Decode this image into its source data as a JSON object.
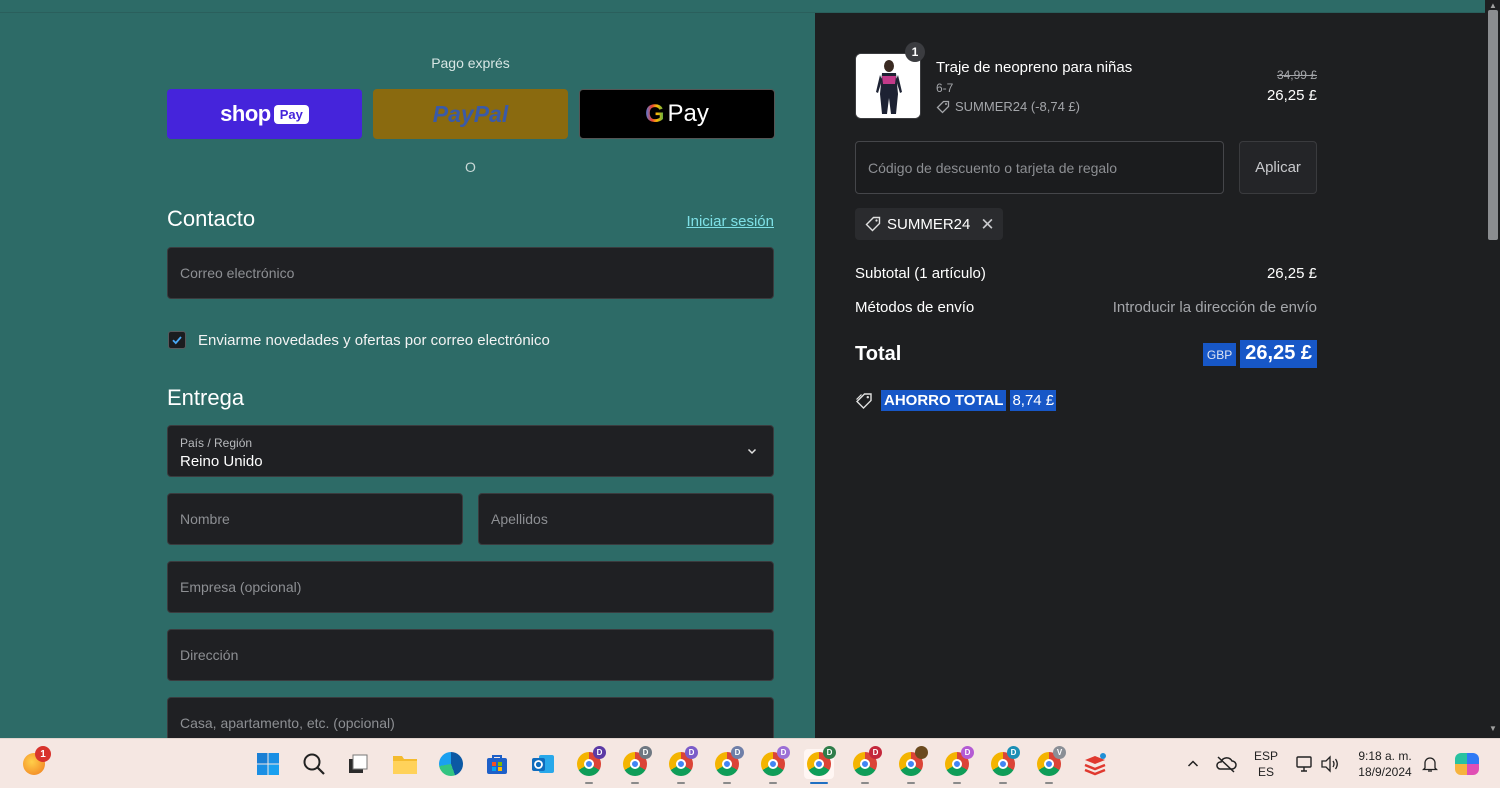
{
  "checkout": {
    "express_label": "Pago exprés",
    "shop_pay": {
      "word": "shop",
      "badge": "Pay"
    },
    "paypal": "PayPal",
    "gpay": {
      "g": "G",
      "word": "Pay"
    },
    "or": "O",
    "contact_title": "Contacto",
    "login_link": "Iniciar sesión",
    "email_placeholder": "Correo electrónico",
    "newsletter_label": "Enviarme novedades y ofertas por correo electrónico",
    "newsletter_checked": true,
    "delivery_title": "Entrega",
    "country_label": "País / Región",
    "country_value": "Reino Unido",
    "first_name_placeholder": "Nombre",
    "last_name_placeholder": "Apellidos",
    "company_placeholder": "Empresa (opcional)",
    "address_placeholder": "Dirección",
    "apartment_placeholder": "Casa, apartamento, etc. (opcional)"
  },
  "summary": {
    "item": {
      "quantity": "1",
      "name": "Traje de neopreno para niñas",
      "variant": "6-7",
      "discount": "SUMMER24 (-8,74 £)",
      "old_price": "34,99 £",
      "price": "26,25 £"
    },
    "discount_placeholder": "Código de descuento o tarjeta de regalo",
    "apply_label": "Aplicar",
    "applied_code": "SUMMER24",
    "subtotal_label": "Subtotal (1 artículo)",
    "subtotal_value": "26,25 £",
    "shipping_label": "Métodos de envío",
    "shipping_value": "Introducir la dirección de envío",
    "total_label": "Total",
    "currency": "GBP",
    "total_value": "26,25 £",
    "savings_label": "AHORRO TOTAL",
    "savings_value": "8,74 £"
  },
  "taskbar": {
    "notification_count": "1",
    "language_top": "ESP",
    "language_bottom": "ES",
    "time": "9:18 a. m.",
    "date": "18/9/2024",
    "chrome_profiles": [
      "D",
      "D",
      "D",
      "D",
      "D",
      "D",
      "D",
      "",
      "D",
      "D",
      "V"
    ]
  },
  "colors": {
    "left_bg": "#2d6b67",
    "right_bg": "#1e1f21",
    "shop_pay": "#4524db",
    "paypal": "#8a6a0f",
    "link": "#7ee0e6",
    "selection": "#1757c7"
  }
}
